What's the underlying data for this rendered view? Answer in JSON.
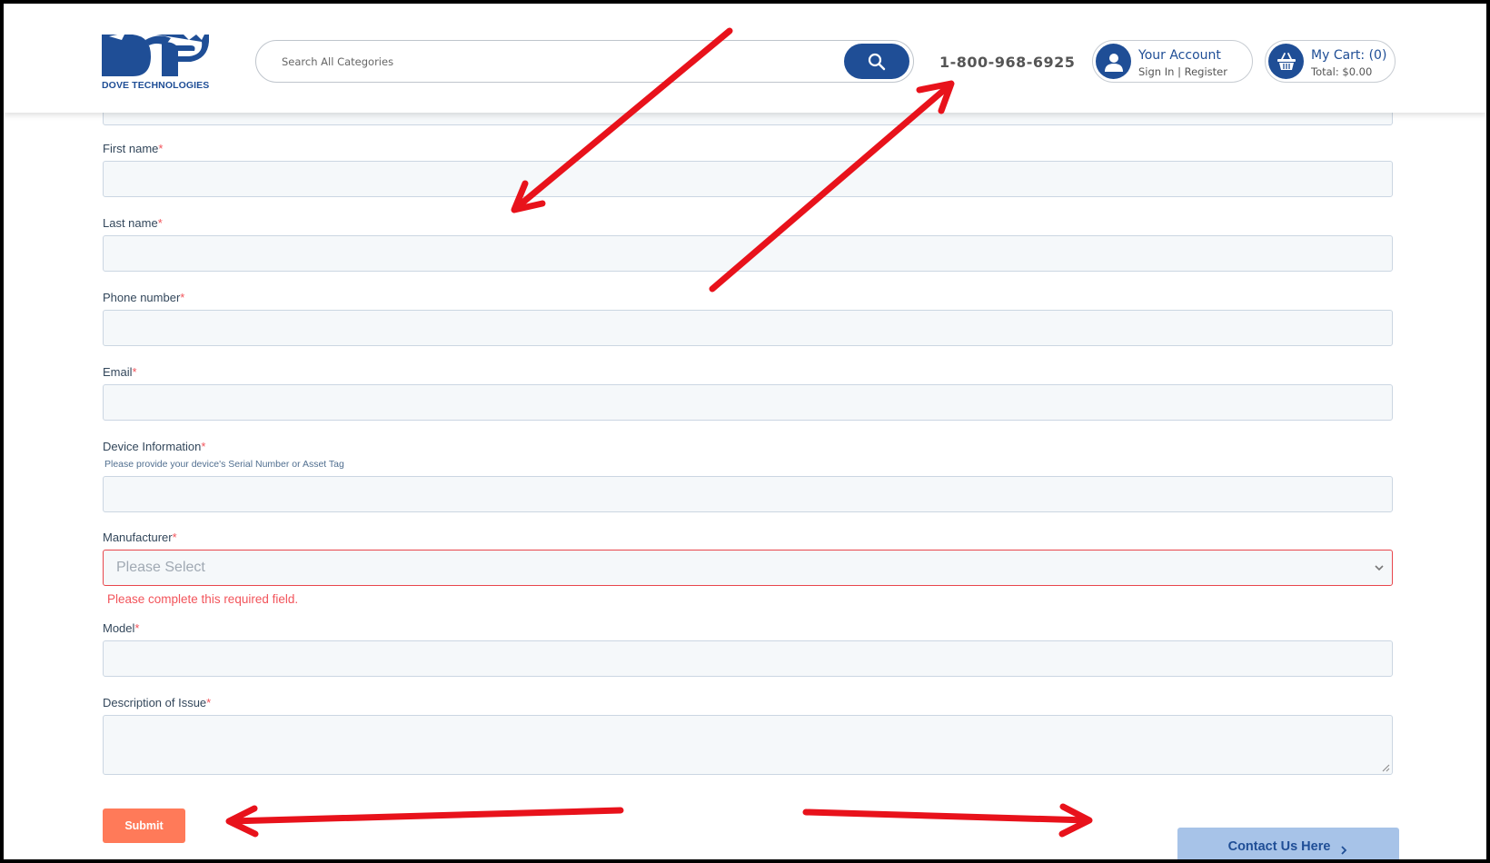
{
  "header": {
    "logo_text": "DOVE TECHNOLOGIES",
    "search_placeholder": "Search All Categories",
    "phone": "1-800-968-6925",
    "account_title": "Your Account",
    "account_sub": "Sign In | Register",
    "cart_title": "My Cart: (0)",
    "cart_sub": "Total: $0.00"
  },
  "form": {
    "first_name_label": "First name",
    "last_name_label": "Last name",
    "phone_label": "Phone number",
    "email_label": "Email",
    "device_label": "Device Information",
    "device_hint": "Please provide your device's Serial Number or Asset Tag",
    "manufacturer_label": "Manufacturer",
    "manufacturer_value": "Please Select",
    "manufacturer_error": "Please complete this required field.",
    "model_label": "Model",
    "description_label": "Description of Issue",
    "required_mark": "*",
    "submit_label": "Submit"
  },
  "contact_label": "Contact Us Here",
  "colors": {
    "brand": "#1f4e96",
    "submit": "#ff7a59",
    "error": "#f2545b",
    "annotation": "#e8121b"
  }
}
